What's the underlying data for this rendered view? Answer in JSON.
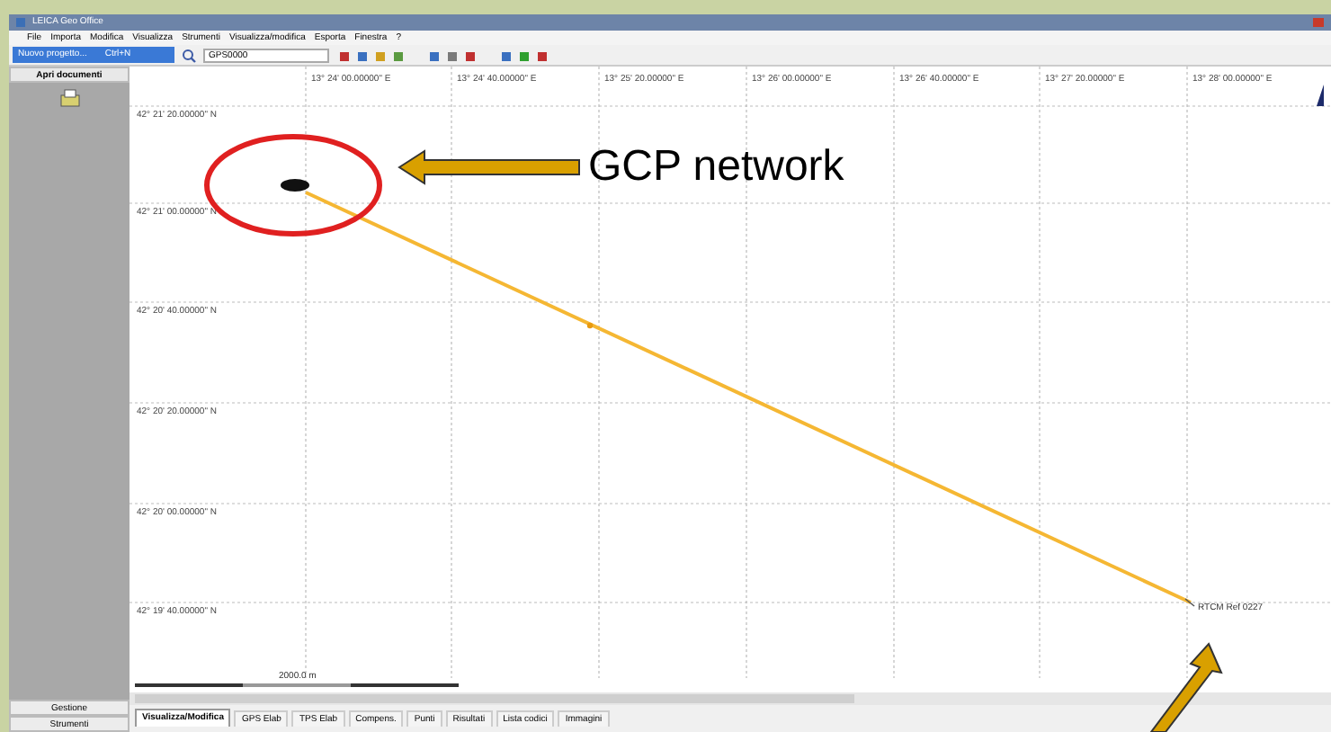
{
  "window": {
    "title": "LEICA Geo Office"
  },
  "menu": [
    "File",
    "Importa",
    "Modifica",
    "Visualizza",
    "Strumenti",
    "Visualizza/modifica",
    "Esporta",
    "Finestra",
    "?"
  ],
  "toolbar": {
    "menu_item": {
      "label": "Nuovo progetto...",
      "shortcut": "Ctrl+N"
    },
    "combo": "GPS0000"
  },
  "sidebar": {
    "header": "Apri documenti",
    "buttons": [
      "Gestione",
      "Strumenti"
    ]
  },
  "map": {
    "x_labels": [
      "13° 24' 00.00000\" E",
      "13° 24' 40.00000\" E",
      "13° 25' 20.00000\" E",
      "13° 26' 00.00000\" E",
      "13° 26' 40.00000\" E",
      "13° 27' 20.00000\" E",
      "13° 28' 00.00000\" E"
    ],
    "y_labels": [
      "42° 21' 20.00000\" N",
      "42° 21' 00.00000\" N",
      "42° 20' 40.00000\" N",
      "42° 20' 20.00000\" N",
      "42° 20' 00.00000\" N",
      "42° 19' 40.00000\" N"
    ],
    "point_label": "RTCM Ref 0227",
    "scale": "2000.0 m"
  },
  "tabs": [
    {
      "label": "Visualizza/Modifica",
      "selected": true
    },
    {
      "label": "GPS Elab",
      "selected": false
    },
    {
      "label": "TPS Elab",
      "selected": false
    },
    {
      "label": "Compens.",
      "selected": false
    },
    {
      "label": "Punti",
      "selected": false
    },
    {
      "label": "Risultati",
      "selected": false
    },
    {
      "label": "Lista codici",
      "selected": false
    },
    {
      "label": "Immagini",
      "selected": false
    }
  ],
  "annotation": {
    "label": "GCP network"
  }
}
